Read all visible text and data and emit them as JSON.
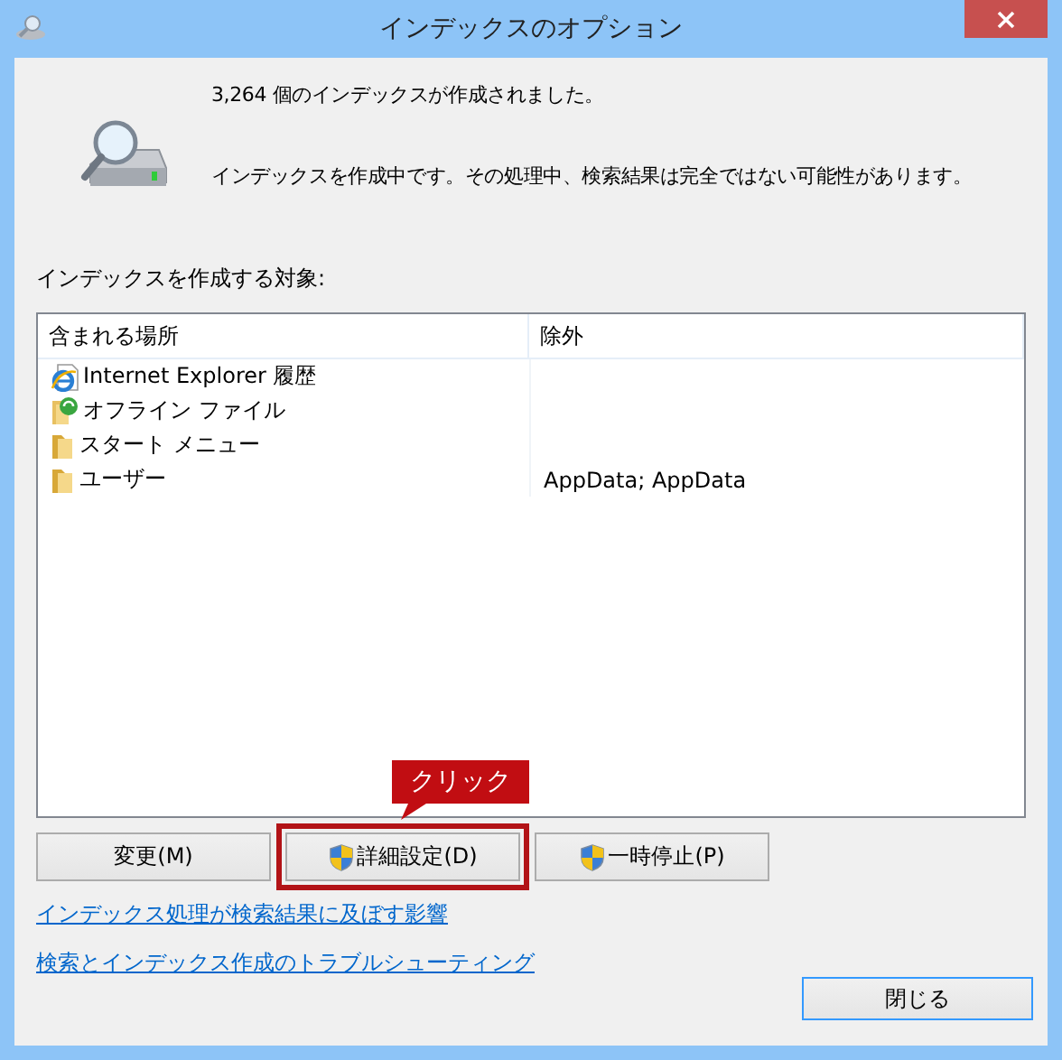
{
  "window": {
    "title": "インデックスのオプション"
  },
  "messages": [
    "3,264 個のインデックスが作成されました。",
    "インデックスを作成中です。その処理中、検索結果は完全ではない可能性があります。"
  ],
  "locations_label": "インデックスを作成する対象:",
  "table": {
    "columns": [
      "含まれる場所",
      "除外"
    ],
    "rows": [
      {
        "kind": "ie",
        "location": "Internet Explorer 履歴",
        "exclude": ""
      },
      {
        "kind": "offline",
        "location": "オフライン ファイル",
        "exclude": ""
      },
      {
        "kind": "folder",
        "location": "スタート メニュー",
        "exclude": ""
      },
      {
        "kind": "folder",
        "location": "ユーザー",
        "exclude": "AppData; AppData"
      }
    ]
  },
  "buttons": [
    {
      "label": "変更(M)",
      "shield": false,
      "highlighted": false
    },
    {
      "label": "詳細設定(D)",
      "shield": true,
      "highlighted": true
    },
    {
      "label": "一時停止(P)",
      "shield": true,
      "highlighted": false
    }
  ],
  "callout": {
    "text": "クリック"
  },
  "links": [
    "インデックス処理が検索結果に及ぼす影響",
    "検索とインデックス作成のトラブルシューティング"
  ],
  "close_button": "閉じる"
}
